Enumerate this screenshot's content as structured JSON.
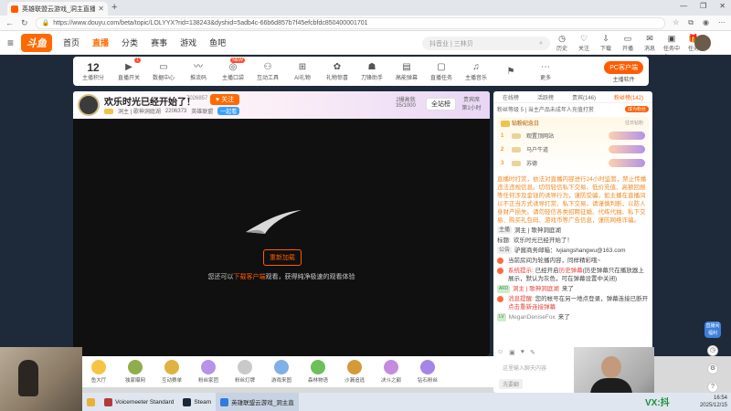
{
  "browser": {
    "tab_title": "英雄联盟云游戏_洞主直播_洞主 | 歌",
    "url": "https://www.douyu.com/beta/topic/LOLYYX?rid=138243&dyshid=5adb4c-66b6d857b7f45efcbfdc850400001701"
  },
  "site": {
    "logo": "斗鱼",
    "nav": [
      "首页",
      "直播",
      "分类",
      "赛事",
      "游戏",
      "鱼吧"
    ],
    "search_placeholder": "抖音业 | 三林贝",
    "header_icons": [
      "历史",
      "关注",
      "下载",
      "开播",
      "消息",
      "任务中心",
      "任务"
    ],
    "message_badge": "16"
  },
  "toolbar": {
    "level": "12",
    "level_label": "主播积分",
    "tools": [
      "直播开关",
      "数据中心",
      "推流码",
      "主播口袋",
      "互动工具",
      "AI礼物",
      "礼物惊喜",
      "刀锋助手",
      "高能弹幕",
      "直播任务",
      "主播音乐",
      "",
      "更多"
    ],
    "badge_first": "1",
    "badge_new": "NEW",
    "pc_button": "PC客户端",
    "pc_caption": "主播软件"
  },
  "room": {
    "title": "欢乐时光已经开始了！",
    "room_id": "7026857",
    "follow": "关注",
    "followers": "2206373",
    "anchor": "洞主 | 歌神洞庭湖",
    "category": "英雄联盟",
    "tag": "一起看",
    "rank_label": "2爆高就",
    "rank_value": "35/1000",
    "allstation": "全站榜",
    "fans_label": "贵宾席",
    "fans_value": "第1小时"
  },
  "video": {
    "reload": "重新加载",
    "tip_before": "您还可以",
    "tip_link": "下载客户端",
    "tip_after": "观看，获得纯净极速的观看体验"
  },
  "chat": {
    "tabs": [
      "在线榜",
      "活跃榜",
      "贵宾(146)",
      "粉丝榜(142)"
    ],
    "subbar_left": "粉丝等级 5 | 当主产品未成年人充值打赏",
    "subbar_tag": "成为粉丝",
    "rank_title": "钻粉纪念日",
    "rank_link": "往日钻粉",
    "rank_rows": [
      {
        "num": "1",
        "name": "观置顶网站"
      },
      {
        "num": "2",
        "name": "马户牛道"
      },
      {
        "num": "3",
        "name": "苏德"
      }
    ],
    "notice": "直播时打赏，依法对直播内容进行24小时监管，禁止传播违法违规信息。切勿轻信私下交易、低价充值、高额回报等任何涉及金钱的诱导行为，谨防受骗，如主播在直播间以不正当方式诱导打赏、私下交易，请谨慎判断，以防人身财产损失。请勿轻信各类招聘征婚、代练代抽、私下交易、购买礼包码、游戏币等广告信息，谨防网络诈骗。",
    "info_anchor_label": "主播",
    "info_anchor": "洞主 | 歌神洞庭湖",
    "info_title_label": "标题:",
    "info_title": "欢乐时光已经开始了！",
    "info_notice_label": "公告",
    "info_notice": "驴酱商务邮箱：lvjiangshangwu@163.com",
    "line1": "当前房间为轮播内容，同样精彩哦~",
    "line2_label": "系统提示:",
    "line2_text": "已经开启",
    "line2_link": "历史弹幕",
    "line2_after": "(历史弹幕只在播放器上展示，默认为灰色，可在弹幕设置中关闭)",
    "line3": "洞主 | 歌神洞庭湖",
    "line3_after": "来了",
    "line4_label": "消息提醒:",
    "line4_text": "您的帐号在另一地点登录，弹幕连接已断开",
    "line4_link": "点击重新连接弹幕",
    "visitor": "MeganDeniseFox",
    "visitor_after": "来了",
    "input_placeholder": "这里输入聊天内容",
    "send": "洗要翻"
  },
  "right_tools": {
    "badge": "直播间 福利"
  },
  "gifts": [
    "鱼大厅",
    "独家曝网",
    "互动赛单",
    "粉丝家团",
    "粉丝灯牌",
    "游戏来图",
    "森林物语",
    "沙漏追逃",
    "决斗之巅",
    "钻石粉丝"
  ],
  "taskbar": {
    "items": [
      "Voicemeeter Standard",
      "Steam",
      "英雄联盟云游戏_洞主直"
    ],
    "time": "16:54",
    "date": "2025/12/15"
  },
  "watermark": "VX:抖"
}
